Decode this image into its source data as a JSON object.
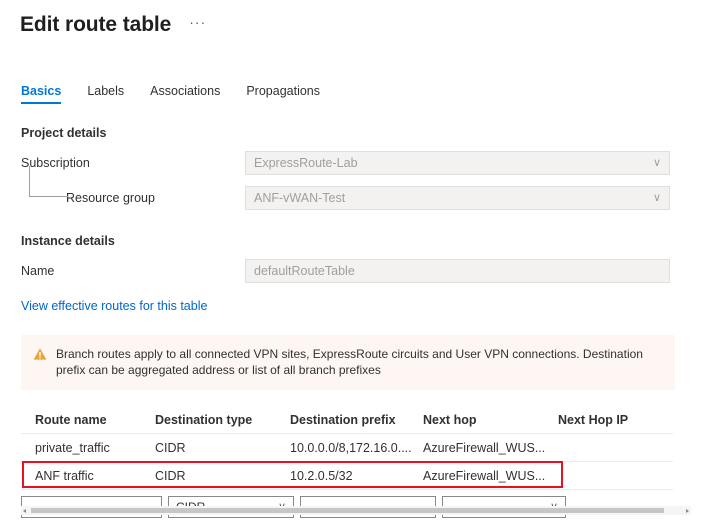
{
  "header": {
    "title": "Edit route table",
    "ellipsis": "···"
  },
  "tabs": [
    {
      "label": "Basics",
      "active": true
    },
    {
      "label": "Labels",
      "active": false
    },
    {
      "label": "Associations",
      "active": false
    },
    {
      "label": "Propagations",
      "active": false
    }
  ],
  "project_details": {
    "heading": "Project details",
    "subscription": {
      "label": "Subscription",
      "value": "ExpressRoute-Lab",
      "chevron": "∨"
    },
    "resource_group": {
      "label": "Resource group",
      "value": "ANF-vWAN-Test",
      "chevron": "∨"
    }
  },
  "instance_details": {
    "heading": "Instance details",
    "name": {
      "label": "Name",
      "value": "defaultRouteTable"
    }
  },
  "effective_routes_link": "View effective routes for this table",
  "warning": {
    "icon": "warning-triangle-icon",
    "text": "Branch routes apply to all connected VPN sites, ExpressRoute circuits and User VPN connections. Destination prefix can be aggregated address or list of all branch prefixes",
    "background": "#fdf6f2",
    "icon_color": "#d29200"
  },
  "routes_table": {
    "columns": [
      "Route name",
      "Destination type",
      "Destination prefix",
      "Next hop",
      "Next Hop IP"
    ],
    "rows": [
      {
        "route_name": "private_traffic",
        "destination_type": "CIDR",
        "destination_prefix": "10.0.0.0/8,172.16.0....",
        "next_hop": "AzureFirewall_WUS...",
        "next_hop_ip": "",
        "highlighted": false
      },
      {
        "route_name": "ANF traffic",
        "destination_type": "CIDR",
        "destination_prefix": "10.2.0.5/32",
        "next_hop": "AzureFirewall_WUS...",
        "next_hop_ip": "",
        "highlighted": true
      }
    ],
    "new_row": {
      "route_name_value": "",
      "route_name_placeholder": "",
      "destination_type_value": "CIDR",
      "destination_type_chevron": "∨",
      "destination_prefix_value": "",
      "destination_prefix_placeholder": "",
      "next_hop_value": "",
      "next_hop_chevron": "∨"
    },
    "highlight_color": "#e81123"
  },
  "scrollbar": {
    "left_arrow": "scroll-left-arrow-icon",
    "right_arrow": "scroll-right-arrow-icon"
  },
  "theme": {
    "accent": "#0078d4",
    "link": "#0066cc",
    "text": "#323130",
    "disabled_field_bg": "#f3f2f1"
  }
}
